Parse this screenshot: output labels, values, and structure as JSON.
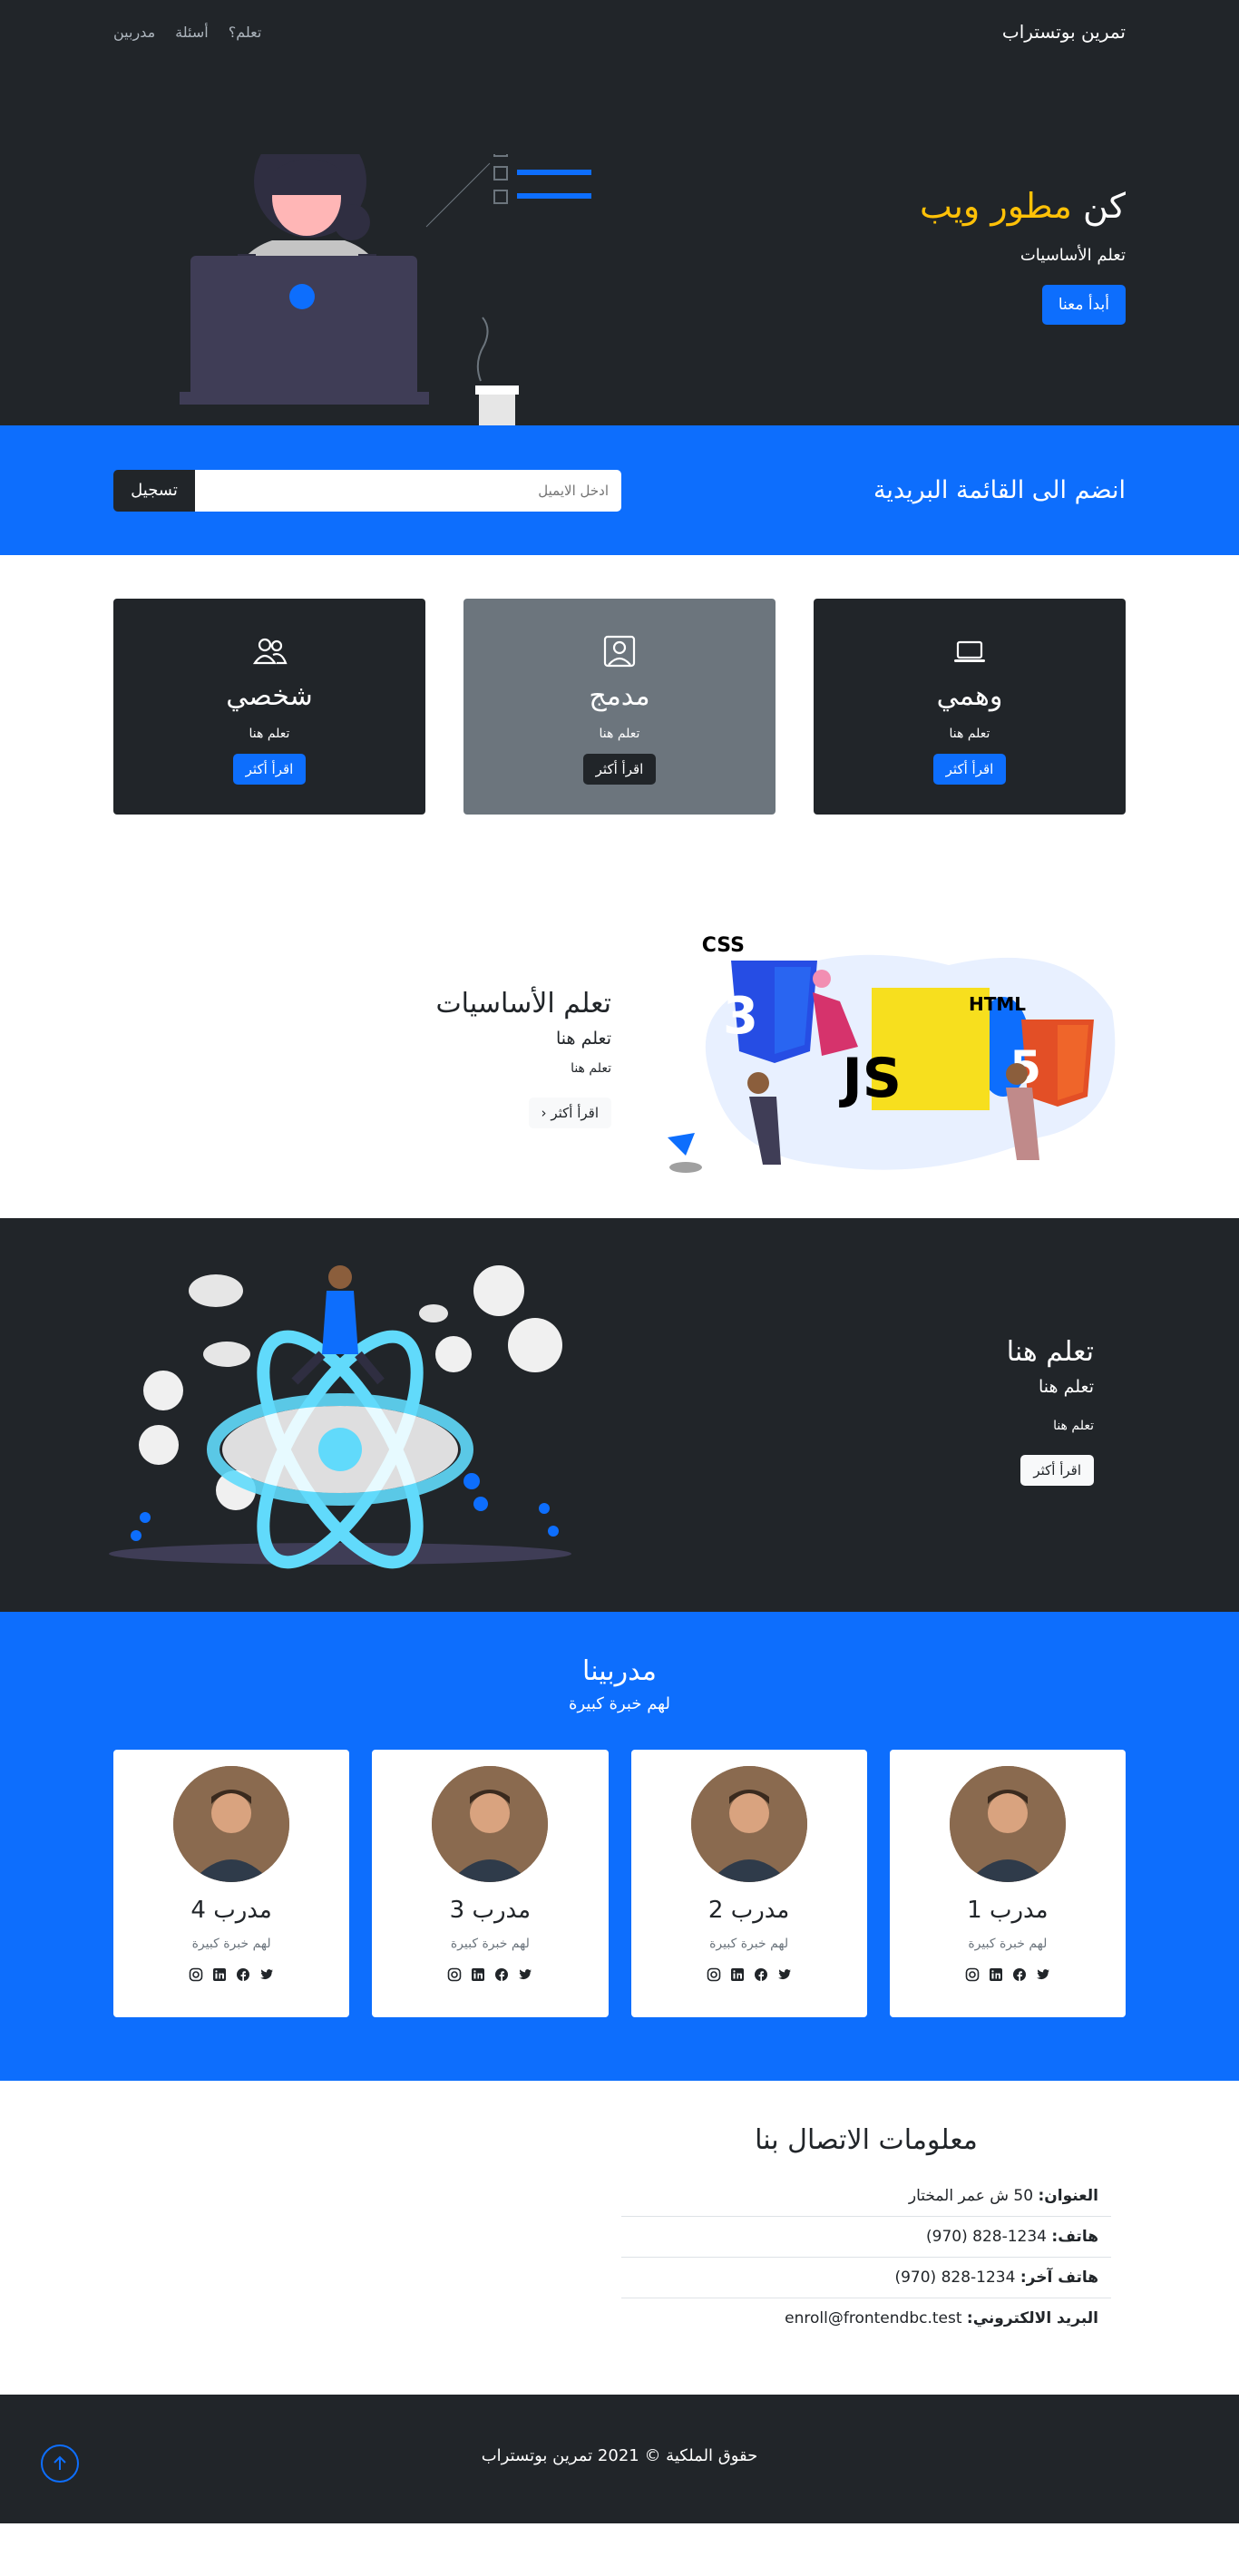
{
  "nav": {
    "brand": "تمرين بوتستراب",
    "links": [
      "مدربين",
      "أسئلة",
      "تعلم؟"
    ]
  },
  "hero": {
    "title_prefix": "كن",
    "title_accent": "مطور ويب",
    "subtitle": "تعلم الأساسيات",
    "button": "أبدأ معنا"
  },
  "newsletter": {
    "title": "انضم الى القائمة البريدية",
    "placeholder": "ادخل الايميل",
    "button": "تسجيل"
  },
  "boxes": [
    {
      "title": "وهمي",
      "text": "تعلم هنا",
      "button": "اقرأ أكثر",
      "icon": "laptop-icon"
    },
    {
      "title": "مدمج",
      "text": "تعلم هنا",
      "button": "اقرأ أكثر",
      "icon": "person-square-icon"
    },
    {
      "title": "شخصي",
      "text": "تعلم هنا",
      "button": "اقرأ أكثر",
      "icon": "people-icon"
    }
  ],
  "learn": {
    "title": "تعلم الأساسيات",
    "subtitle": "تعلم هنا",
    "text": "تعلم هنا",
    "button": "اقرأ أكثر",
    "logos": [
      "CSS",
      "JS",
      "HTML"
    ]
  },
  "react": {
    "title": "تعلم هنا",
    "subtitle": "تعلم هنا",
    "text": "تعلم هنا",
    "button": "اقرأ أكثر"
  },
  "trainers": {
    "title": "مدربينا",
    "subtitle": "لهم خبرة كبيرة",
    "cards": [
      {
        "name": "مدرب 1",
        "text": "لهم خبرة كبيرة"
      },
      {
        "name": "مدرب 2",
        "text": "لهم خبرة كبيرة"
      },
      {
        "name": "مدرب 3",
        "text": "لهم خبرة كبيرة"
      },
      {
        "name": "مدرب 4",
        "text": "لهم خبرة كبيرة"
      }
    ],
    "socials": [
      "twitter-icon",
      "facebook-icon",
      "linkedin-icon",
      "instagram-icon"
    ]
  },
  "contact": {
    "title": "معلومات الاتصال بنا",
    "rows": [
      {
        "label": "العنوان:",
        "value": "50 ش عمر المختار"
      },
      {
        "label": "هاتف:",
        "value": "(970) 828-1234"
      },
      {
        "label": "هاتف آخر:",
        "value": "(970) 828-1234"
      },
      {
        "label": "البريد الالكتروني:",
        "value": "enroll@frontendbc.test"
      }
    ]
  },
  "footer": {
    "text": "حقوق الملكية © 2021 تمرين بوتستراب"
  },
  "colors": {
    "dark": "#212529",
    "primary": "#0d6efd",
    "accent": "#ffc107",
    "gray": "#6c757d"
  }
}
